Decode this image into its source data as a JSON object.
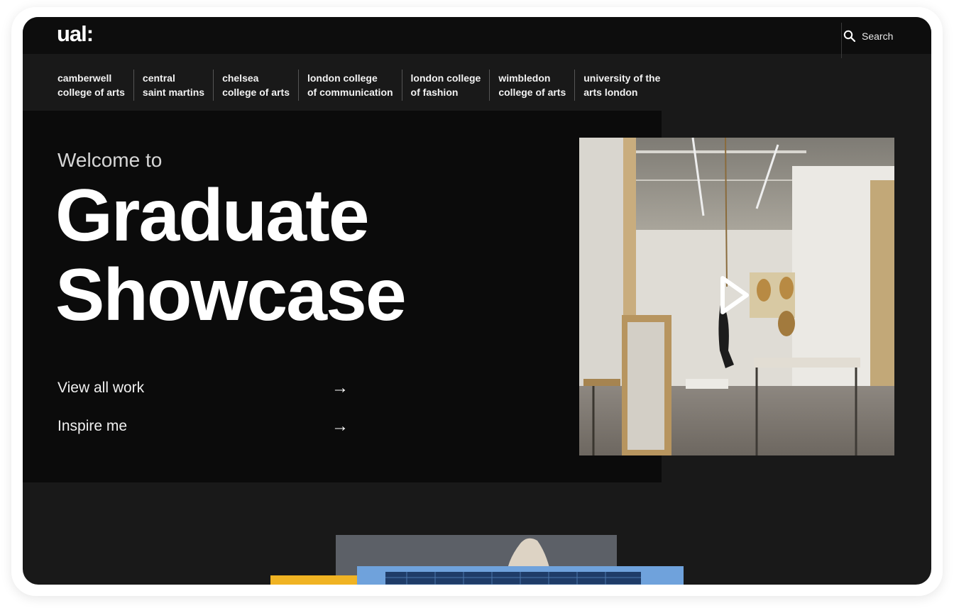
{
  "header": {
    "logo": "ual:",
    "search_label": "Search"
  },
  "colleges": [
    {
      "label": "camberwell\ncollege of arts"
    },
    {
      "label": "central\nsaint martins"
    },
    {
      "label": "chelsea\ncollege of arts"
    },
    {
      "label": "london college\nof communication"
    },
    {
      "label": "london college\nof fashion"
    },
    {
      "label": "wimbledon\ncollege of arts"
    },
    {
      "label": "university of the\narts london"
    }
  ],
  "hero": {
    "welcome": "Welcome to",
    "headline_line1": "Graduate",
    "headline_line2": "Showcase",
    "links": [
      {
        "label": "View all work",
        "arrow": "→"
      },
      {
        "label": "Inspire me",
        "arrow": "→"
      }
    ]
  },
  "colors": {
    "background": "#191919",
    "hero_panel": "#0b0b0b",
    "accent_yellow": "#f0b323",
    "text": "#ffffff"
  },
  "icons": {
    "search": "search-icon",
    "play": "play-icon",
    "arrow": "arrow-right-icon"
  }
}
